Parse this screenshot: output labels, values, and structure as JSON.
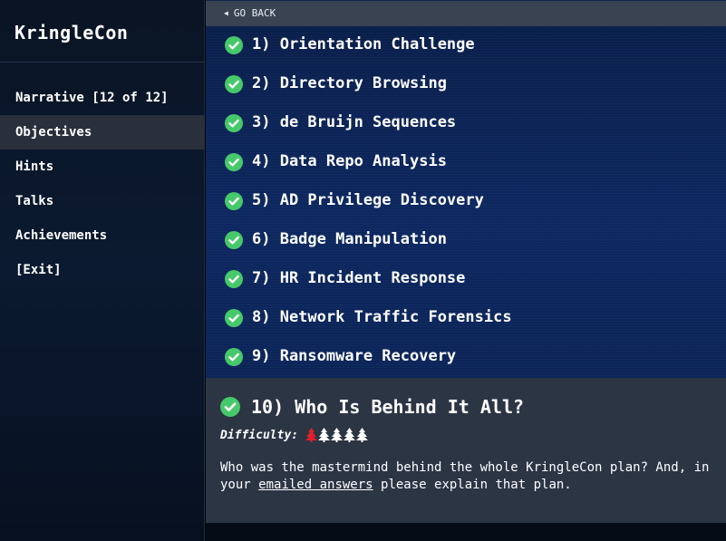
{
  "sidebar": {
    "title": "KringleCon",
    "items": [
      {
        "label": "Narrative [12 of 12]",
        "active": false
      },
      {
        "label": "Objectives",
        "active": true
      },
      {
        "label": "Hints",
        "active": false
      },
      {
        "label": "Talks",
        "active": false
      },
      {
        "label": "Achievements",
        "active": false
      },
      {
        "label": "[Exit]",
        "active": false
      }
    ]
  },
  "main": {
    "go_back_label": "GO BACK",
    "objectives": [
      "1) Orientation Challenge",
      "2) Directory Browsing",
      "3) de Bruijn Sequences",
      "4) Data Repo Analysis",
      "5) AD Privilege Discovery",
      "6) Badge Manipulation",
      "7) HR Incident Response",
      "8) Network Traffic Forensics",
      "9) Ransomware Recovery"
    ],
    "selected": {
      "title": "10) Who Is Behind It All?",
      "difficulty_label": "Difficulty:",
      "difficulty_level": 1,
      "difficulty_max": 5,
      "description_part1": "Who was the mastermind behind the whole KringleCon plan? And, in your ",
      "description_link": "emailed answers",
      "description_part2": " please explain that plan."
    }
  },
  "colors": {
    "check_green": "#46c96a",
    "tree_red": "#e0202a",
    "tree_white": "#ffffff",
    "active_nav_bg": "#29303c",
    "detail_bg": "#2c3544"
  },
  "icons": {
    "objective_status": "check-circle-icon",
    "difficulty": "tree-icon",
    "back": "triangle-left-icon"
  }
}
